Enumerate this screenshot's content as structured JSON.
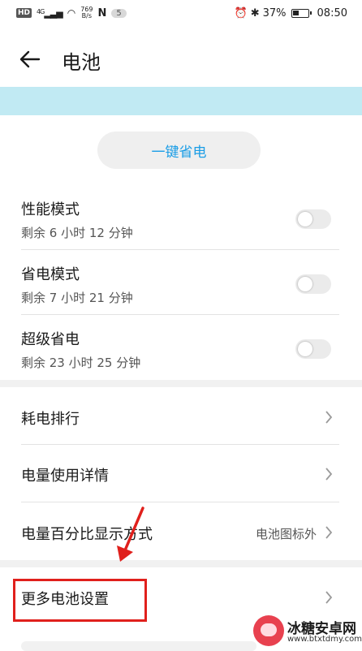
{
  "status_bar": {
    "hd": "HD",
    "network": "4G",
    "speed_top": "769",
    "speed_bottom": "B/s",
    "nfc": "N",
    "notification_count": "5",
    "alarm": "⏰",
    "bluetooth": "✱",
    "battery_percent": "37%",
    "time": "08:50"
  },
  "header": {
    "title": "电池"
  },
  "one_key_button": {
    "label": "一键省电"
  },
  "modes": [
    {
      "title": "性能模式",
      "remaining": "剩余 6 小时 12 分钟",
      "enabled": false
    },
    {
      "title": "省电模式",
      "remaining": "剩余 7 小时 21 分钟",
      "enabled": false
    },
    {
      "title": "超级省电",
      "remaining": "剩余 23 小时 25 分钟",
      "enabled": false
    }
  ],
  "menu": [
    {
      "label": "耗电排行",
      "value": ""
    },
    {
      "label": "电量使用详情",
      "value": ""
    },
    {
      "label": "电量百分比显示方式",
      "value": "电池图标外"
    },
    {
      "label": "更多电池设置",
      "value": ""
    }
  ],
  "watermark": {
    "name": "冰糖安卓网",
    "url": "www.btxtdmy.com"
  },
  "colors": {
    "accent": "#1a9de6",
    "banner": "#c1eaf3",
    "highlight": "#e0201c"
  }
}
